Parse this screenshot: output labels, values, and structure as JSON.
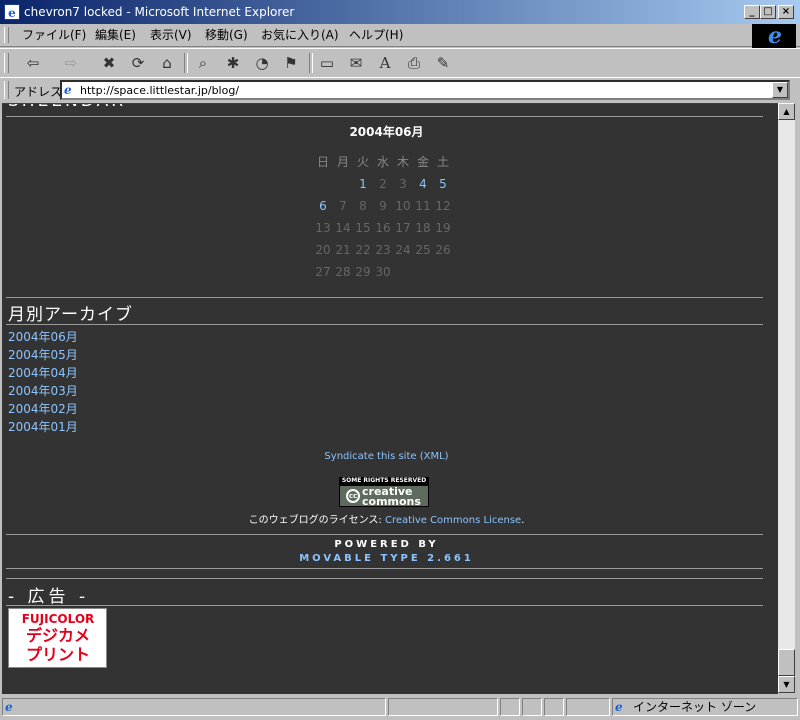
{
  "window": {
    "title": "chevron7 locked - Microsoft Internet Explorer",
    "app_icon": "e",
    "btn_minimize": "_",
    "btn_maximize": "□",
    "btn_close": "×"
  },
  "menu": {
    "items": [
      "ファイル(F)",
      "編集(E)",
      "表示(V)",
      "移動(G)",
      "お気に入り(A)",
      "ヘルプ(H)"
    ]
  },
  "toolbar": {
    "icons": [
      "back-icon",
      "forward-icon",
      "stop-icon",
      "refresh-icon",
      "home-icon",
      "search-icon",
      "favorites-icon",
      "history-icon",
      "channels-icon",
      "fullscreen-icon",
      "mail-icon",
      "font-icon",
      "print-icon",
      "edit-icon"
    ],
    "glyphs": [
      "⇦",
      "⇨",
      "✖",
      "⟳",
      "⌂",
      "⌕",
      "✱",
      "◔",
      "⚑",
      "▭",
      "✉",
      "A",
      "⎙",
      "✎"
    ]
  },
  "address": {
    "label": "アドレス",
    "url": "http://space.littlestar.jp/blog/"
  },
  "page": {
    "top_partial_title": "SHEENDAR",
    "calendar": {
      "caption": "2004年06月",
      "weekdays": [
        "日",
        "月",
        "火",
        "水",
        "木",
        "金",
        "土"
      ],
      "weeks": [
        [
          "",
          "",
          "1",
          "2",
          "3",
          "4",
          "5"
        ],
        [
          "6",
          "7",
          "8",
          "9",
          "10",
          "11",
          "12"
        ],
        [
          "13",
          "14",
          "15",
          "16",
          "17",
          "18",
          "19"
        ],
        [
          "20",
          "21",
          "22",
          "23",
          "24",
          "25",
          "26"
        ],
        [
          "27",
          "28",
          "29",
          "30",
          "",
          "",
          ""
        ]
      ],
      "linked_days": [
        "1",
        "4",
        "5",
        "6"
      ]
    },
    "archive": {
      "title": "月別アーカイブ",
      "links": [
        "2004年06月",
        "2004年05月",
        "2004年04月",
        "2004年03月",
        "2004年02月",
        "2004年01月"
      ]
    },
    "syndicate": "Syndicate this site (XML)",
    "cc_badge": {
      "top_text": "SOME RIGHTS RESERVED",
      "cc": "cc",
      "word1": "creative",
      "word2": "commons"
    },
    "license": {
      "prefix": "このウェブログのライセンス: ",
      "link": "Creative Commons License",
      "suffix": "."
    },
    "powered_by": "POWERED BY",
    "movable_type": "MOVABLE TYPE 2.661",
    "ad": {
      "title": "- 広告 -",
      "banner_line1": "FUJICOLOR",
      "banner_line2": "デジカメ",
      "banner_line3": "プリント"
    }
  },
  "colors": {
    "page_bg": "#333333",
    "link": "#8cc4ff",
    "rule": "#9a9a9a",
    "chrome": "#c0c0c0"
  },
  "statusbar": {
    "zone": "インターネット ゾーン"
  }
}
